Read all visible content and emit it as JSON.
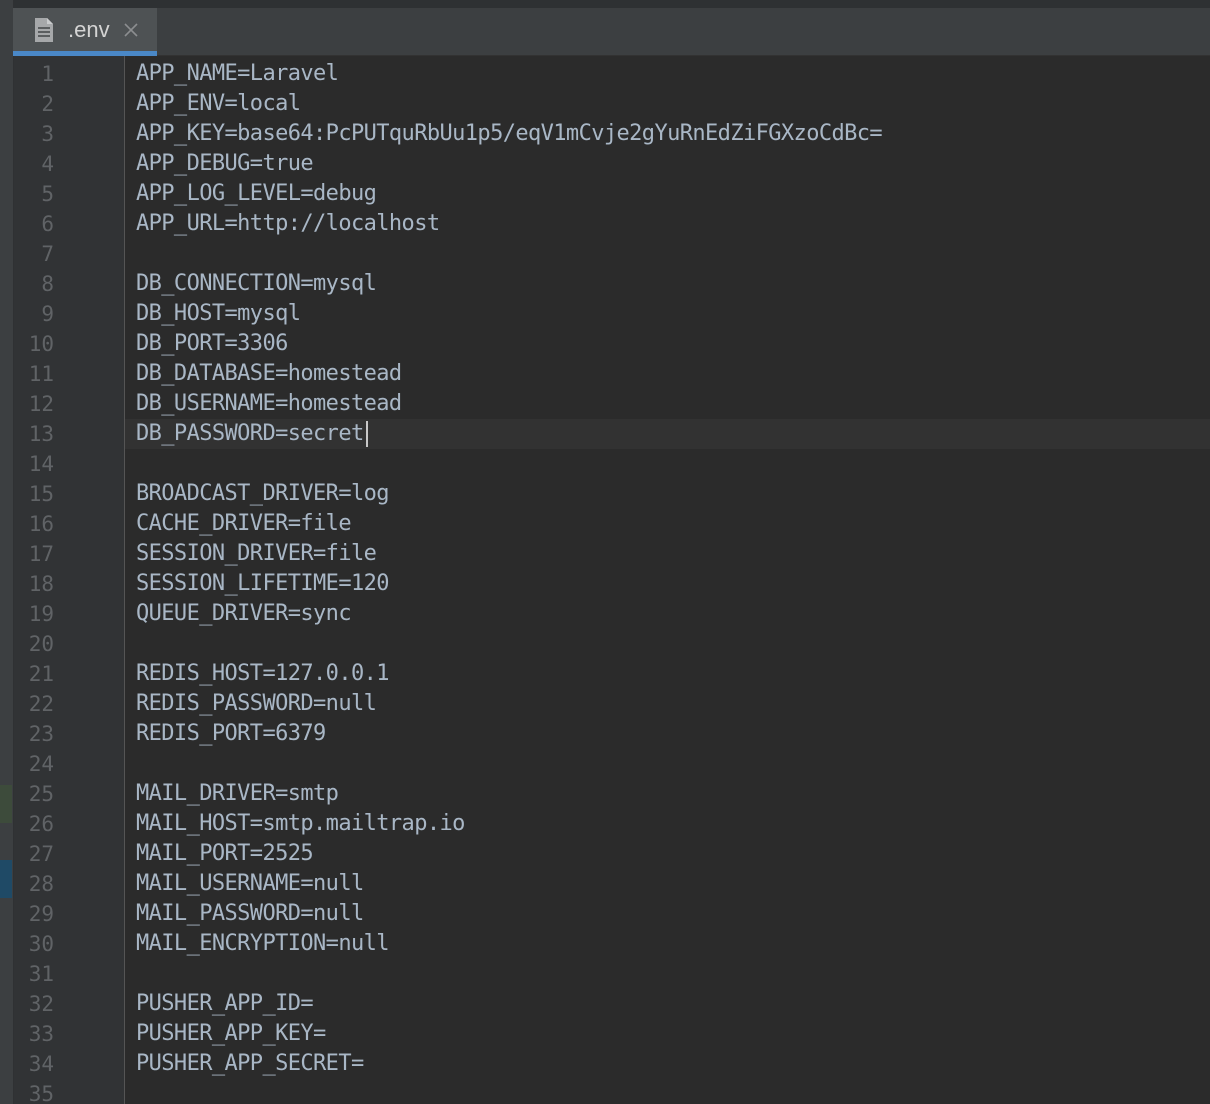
{
  "tab": {
    "label": ".env",
    "file_icon": "text-file-icon",
    "close_icon": "close-icon"
  },
  "editor": {
    "current_line": 13,
    "line_numbers": [
      "1",
      "2",
      "3",
      "4",
      "5",
      "6",
      "7",
      "8",
      "9",
      "10",
      "11",
      "12",
      "13",
      "14",
      "15",
      "16",
      "17",
      "18",
      "19",
      "20",
      "21",
      "22",
      "23",
      "24",
      "25",
      "26",
      "27",
      "28",
      "29",
      "30",
      "31",
      "32",
      "33",
      "34",
      "35"
    ],
    "lines": [
      "APP_NAME=Laravel",
      "APP_ENV=local",
      "APP_KEY=base64:PcPUTquRbUu1p5/eqV1mCvje2gYuRnEdZiFGXzoCdBc=",
      "APP_DEBUG=true",
      "APP_LOG_LEVEL=debug",
      "APP_URL=http://localhost",
      "",
      "DB_CONNECTION=mysql",
      "DB_HOST=mysql",
      "DB_PORT=3306",
      "DB_DATABASE=homestead",
      "DB_USERNAME=homestead",
      "DB_PASSWORD=secret",
      "",
      "BROADCAST_DRIVER=log",
      "CACHE_DRIVER=file",
      "SESSION_DRIVER=file",
      "SESSION_LIFETIME=120",
      "QUEUE_DRIVER=sync",
      "",
      "REDIS_HOST=127.0.0.1",
      "REDIS_PASSWORD=null",
      "REDIS_PORT=6379",
      "",
      "MAIL_DRIVER=smtp",
      "MAIL_HOST=smtp.mailtrap.io",
      "MAIL_PORT=2525",
      "MAIL_USERNAME=null",
      "MAIL_PASSWORD=null",
      "MAIL_ENCRYPTION=null",
      "",
      "PUSHER_APP_ID=",
      "PUSHER_APP_KEY=",
      "PUSHER_APP_SECRET=",
      ""
    ]
  },
  "colors": {
    "background": "#2b2b2b",
    "gutter": "#313335",
    "text": "#a9b7c6",
    "line_number": "#606366",
    "tab_active": "#4e5254",
    "tab_underline": "#4a88c7"
  }
}
